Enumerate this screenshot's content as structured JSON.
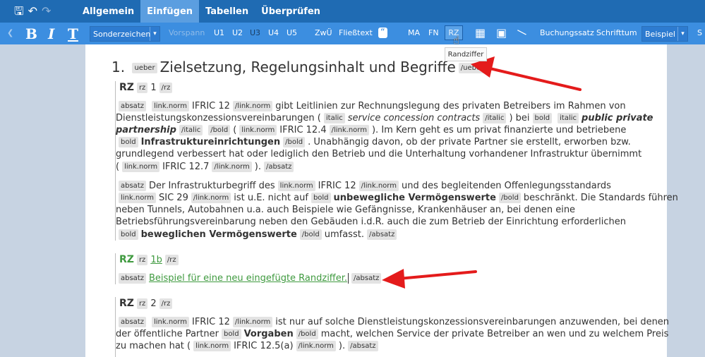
{
  "menubar": {
    "tabs": [
      {
        "label": "Allgemein",
        "active": false
      },
      {
        "label": "Einfügen",
        "active": true
      },
      {
        "label": "Tabellen",
        "active": false
      },
      {
        "label": "Überprüfen",
        "active": false
      }
    ]
  },
  "toolbar": {
    "bold_label": "B",
    "italic_label": "I",
    "text_label": "T",
    "style_select": "Sonderzeichen",
    "vorspann": "Vorspann",
    "headings": [
      "U1",
      "U2",
      "U3",
      "U4",
      "U5"
    ],
    "zwue": "ZwÜ",
    "fliesstext": "Fließtext",
    "quote_icon": "quote-icon",
    "ma": "MA",
    "fn": "FN",
    "rz": "RZ",
    "buchungssatz": "Buchungssatz",
    "schriftum": "Schrifttum",
    "beispiel_select": "Beispiel",
    "s_label": "S"
  },
  "tooltip": "Randziffer",
  "content": {
    "heading": {
      "number": "1.",
      "tag_open": "ueber",
      "text": "Zielsetzung, Regelungsinhalt und Begriffe",
      "tag_close": "/ueber"
    },
    "rz1": {
      "label": "RZ",
      "tag": "rz",
      "num": "1",
      "tag_close": "/rz"
    },
    "p1": {
      "l1": {
        "t1": "absatz",
        "t2": "link.norm",
        "s1": "IFRIC 12",
        "t3": "/link.norm",
        "s2": "gibt Leitlinien zur Rechnungslegung des privaten Betreibers im Rahmen von"
      },
      "l2": {
        "s1": "Dienstleistungskonzessionsvereinbarungen (",
        "t1": "italic",
        "i1": "service concession contracts",
        "t2": "/italic",
        "s2": ") bei",
        "t3": "bold",
        "t4": "italic",
        "bi1": "public private"
      },
      "l3": {
        "bi1": "partnership",
        "t1": "/italic",
        "t2": "/bold",
        "s1": "(",
        "t3": "link.norm",
        "s2": "IFRIC 12.4",
        "t4": "/link.norm",
        "s3": "). Im Kern geht es um privat finanzierte und betriebene"
      },
      "l4": {
        "t1": "bold",
        "b1": "Infrastruktureinrichtungen",
        "t2": "/bold",
        "s1": ". Unabhängig davon, ob der private Partner sie erstellt, erworben bzw."
      },
      "l5": {
        "s1": "grundlegend verbessert hat oder lediglich den Betrieb und die Unterhaltung vorhandener Infrastruktur übernimmt"
      },
      "l6": {
        "s1": "(",
        "t1": "link.norm",
        "s2": "IFRIC 12.7",
        "t2": "/link.norm",
        "s3": ").",
        "t3": "/absatz"
      }
    },
    "p2": {
      "l1": {
        "t1": "absatz",
        "s1": "Der Infrastrukturbegriff des",
        "t2": "link.norm",
        "s2": "IFRIC 12",
        "t3": "/link.norm",
        "s3": "und des begleitenden Offenlegungsstandards"
      },
      "l2": {
        "t1": "link.norm",
        "s1": "SIC 29",
        "t2": "/link.norm",
        "s2": "ist u.E. nicht auf",
        "t3": "bold",
        "b1": "unbewegliche Vermögenswerte",
        "t4": "/bold",
        "s3": "beschränkt. Die Standards führen"
      },
      "l3": {
        "s1": "neben Tunnels, Autobahnen u.a. auch Beispiele wie Gefängnisse, Krankenhäuser an, bei denen eine"
      },
      "l4": {
        "s1": "Betriebsführungsvereinbarung neben den Gebäuden i.d.R. auch die zum Betrieb der Einrichtung erforderlichen"
      },
      "l5": {
        "t1": "bold",
        "b1": "beweglichen Vermögenswerte",
        "t2": "/bold",
        "s1": "umfasst.",
        "t3": "/absatz"
      }
    },
    "rz1b": {
      "label": "RZ",
      "tag": "rz",
      "num": "1b",
      "tag_close": "/rz"
    },
    "p3": {
      "t1": "absatz",
      "s1": "Beispiel für eine neu eingefügte Randziffer.",
      "t2": "/absatz"
    },
    "rz2": {
      "label": "RZ",
      "tag": "rz",
      "num": "2",
      "tag_close": "/rz"
    },
    "p4": {
      "l1": {
        "t1": "absatz",
        "t2": "link.norm",
        "s1": "IFRIC 12",
        "t3": "/link.norm",
        "s2": "ist nur auf solche Dienstleistungskonzessionsvereinbarungen anzuwenden, bei denen"
      },
      "l2": {
        "s1": "der öffentliche Partner",
        "t1": "bold",
        "b1": "Vorgaben",
        "t2": "/bold",
        "s2": "macht, welchen Service der private Betreiber an wen und zu welchem Preis"
      },
      "l3": {
        "s1": "zu machen hat (",
        "t1": "link.norm",
        "s2": "IFRIC 12.5(a)",
        "t2": "/link.norm",
        "s3": ").",
        "t3": "/absatz"
      }
    }
  },
  "colors": {
    "menubar": "#1f6bb3",
    "toolbar": "#3c8ee0",
    "active_tab": "#5b9ee0",
    "inserted_text": "#3f9a3f",
    "arrow": "#e41b1b"
  }
}
